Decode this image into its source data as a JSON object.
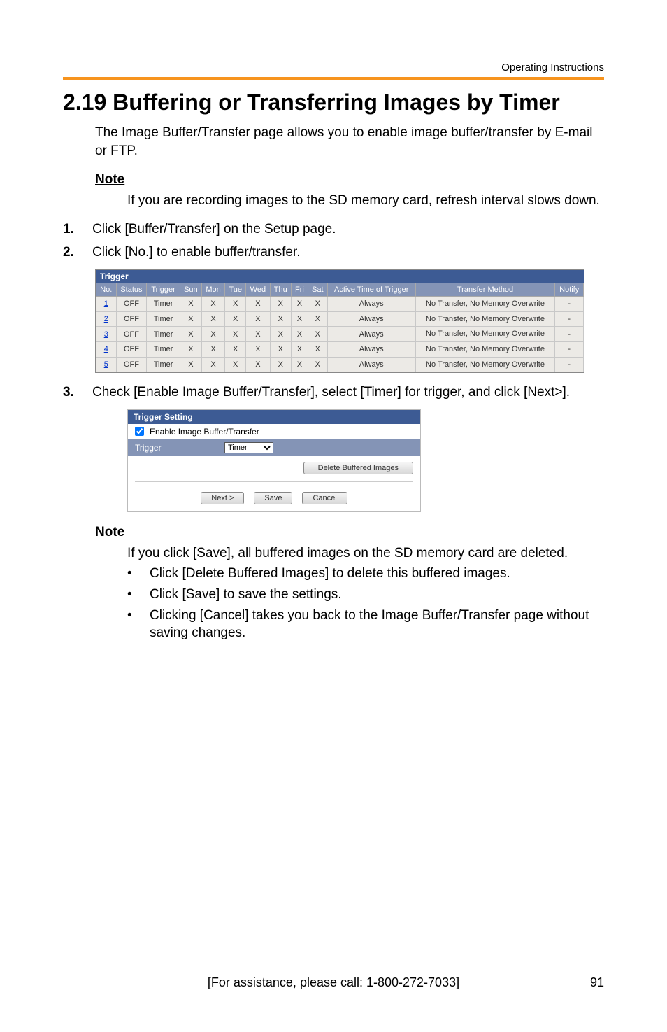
{
  "header_right": "Operating Instructions",
  "section_title": "2.19  Buffering or Transferring Images by Timer",
  "intro": "The Image Buffer/Transfer page allows you to enable image buffer/transfer by E-mail or FTP.",
  "note_label": "Note",
  "note1": "If you are recording images to the SD memory card, refresh interval slows down.",
  "steps": [
    {
      "n": "1.",
      "text": "Click [Buffer/Transfer] on the Setup page."
    },
    {
      "n": "2.",
      "text": "Click [No.] to enable buffer/transfer."
    },
    {
      "n": "3.",
      "text": "Check [Enable Image Buffer/Transfer], select [Timer] for trigger, and click [Next>]."
    }
  ],
  "trigger": {
    "title": "Trigger",
    "cols": [
      "No.",
      "Status",
      "Trigger",
      "Sun",
      "Mon",
      "Tue",
      "Wed",
      "Thu",
      "Fri",
      "Sat",
      "Active Time of Trigger",
      "Transfer Method",
      "Notify"
    ],
    "rows": [
      {
        "no": "1",
        "status": "OFF",
        "trigger": "Timer",
        "d": [
          "X",
          "X",
          "X",
          "X",
          "X",
          "X",
          "X"
        ],
        "active": "Always",
        "method": "No Transfer, No Memory Overwrite",
        "notify": "-"
      },
      {
        "no": "2",
        "status": "OFF",
        "trigger": "Timer",
        "d": [
          "X",
          "X",
          "X",
          "X",
          "X",
          "X",
          "X"
        ],
        "active": "Always",
        "method": "No Transfer, No Memory Overwrite",
        "notify": "-"
      },
      {
        "no": "3",
        "status": "OFF",
        "trigger": "Timer",
        "d": [
          "X",
          "X",
          "X",
          "X",
          "X",
          "X",
          "X"
        ],
        "active": "Always",
        "method": "No Transfer, No Memory Overwrite",
        "notify": "-"
      },
      {
        "no": "4",
        "status": "OFF",
        "trigger": "Timer",
        "d": [
          "X",
          "X",
          "X",
          "X",
          "X",
          "X",
          "X"
        ],
        "active": "Always",
        "method": "No Transfer, No Memory Overwrite",
        "notify": "-"
      },
      {
        "no": "5",
        "status": "OFF",
        "trigger": "Timer",
        "d": [
          "X",
          "X",
          "X",
          "X",
          "X",
          "X",
          "X"
        ],
        "active": "Always",
        "method": "No Transfer, No Memory Overwrite",
        "notify": "-"
      }
    ]
  },
  "setting": {
    "title": "Trigger Setting",
    "enable_label": "Enable Image Buffer/Transfer",
    "trigger_label": "Trigger",
    "trigger_value": "Timer",
    "delete_btn": "Delete Buffered Images",
    "next_btn": "Next >",
    "save_btn": "Save",
    "cancel_btn": "Cancel"
  },
  "note2": "If you click [Save], all buffered images on the SD memory card are deleted.",
  "bullets": [
    "Click [Delete Buffered Images] to delete this buffered images.",
    "Click [Save] to save the settings.",
    "Clicking [Cancel] takes you back to the Image Buffer/Transfer page without saving changes."
  ],
  "footer_center": "[For assistance, please call: 1-800-272-7033]",
  "footer_page": "91"
}
